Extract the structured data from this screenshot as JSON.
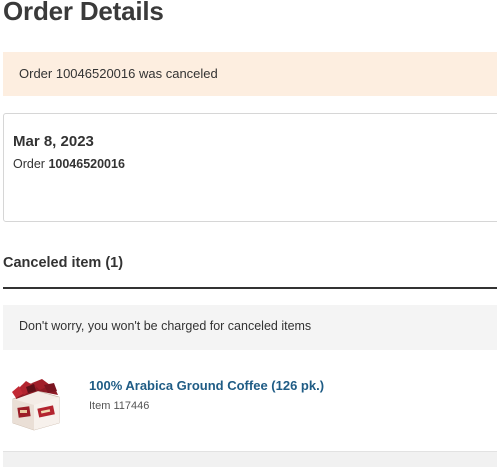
{
  "page": {
    "title": "Order Details"
  },
  "banner": {
    "message": "Order 10046520016 was canceled"
  },
  "order": {
    "date": "Mar 8, 2023",
    "number_label": "Order",
    "number": "10046520016"
  },
  "canceled_section": {
    "heading": "Canceled item (1)",
    "notice": "Don't worry, you won't be charged for canceled items"
  },
  "item": {
    "name": "100% Arabica Ground Coffee (126 pk.)",
    "item_label": "Item",
    "item_number": "117446",
    "image_icon": "coffee-box-icon"
  },
  "colors": {
    "banner_bg": "#fdeee0",
    "link": "#1f5c85",
    "info_bg": "#f4f4f4"
  }
}
